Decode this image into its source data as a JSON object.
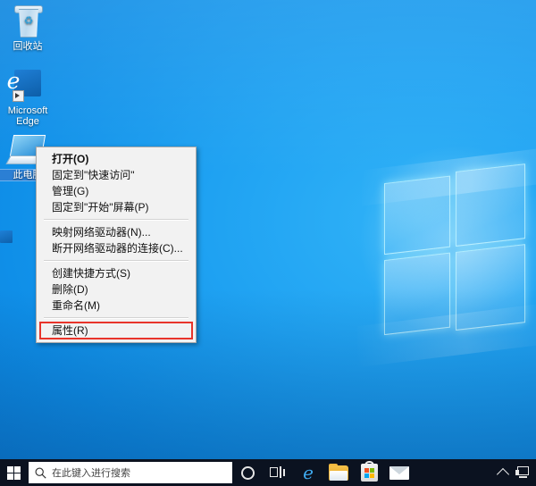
{
  "desktop": {
    "icons": [
      {
        "label": "回收站",
        "icon": "recycle-bin-icon",
        "selected": false
      },
      {
        "label": "Microsoft Edge",
        "icon": "edge-icon",
        "selected": false
      },
      {
        "label": "此电脑",
        "icon": "this-pc-icon",
        "selected": true
      }
    ]
  },
  "context_menu": {
    "groups": [
      {
        "items": [
          {
            "label": "打开(O)",
            "bold": true,
            "marked": false
          },
          {
            "label": "固定到\"快速访问\"",
            "bold": false,
            "marked": false
          },
          {
            "label": "管理(G)",
            "bold": false,
            "marked": false
          },
          {
            "label": "固定到\"开始\"屏幕(P)",
            "bold": false,
            "marked": false
          }
        ]
      },
      {
        "items": [
          {
            "label": "映射网络驱动器(N)...",
            "bold": false,
            "marked": false
          },
          {
            "label": "断开网络驱动器的连接(C)...",
            "bold": false,
            "marked": false
          }
        ]
      },
      {
        "items": [
          {
            "label": "创建快捷方式(S)",
            "bold": false,
            "marked": false
          },
          {
            "label": "删除(D)",
            "bold": false,
            "marked": false
          },
          {
            "label": "重命名(M)",
            "bold": false,
            "marked": false
          }
        ]
      },
      {
        "items": [
          {
            "label": "属性(R)",
            "bold": false,
            "marked": true
          }
        ]
      }
    ],
    "highlight_color": "#e8342a"
  },
  "taskbar": {
    "start_label": "开始",
    "search_placeholder": "在此键入进行搜索",
    "cortana_label": "Cortana",
    "taskview_label": "任务视图",
    "pinned": [
      {
        "name": "Microsoft Edge",
        "icon": "edge-icon"
      },
      {
        "name": "文件资源管理器",
        "icon": "file-explorer-icon"
      },
      {
        "name": "Microsoft Store",
        "icon": "store-icon"
      },
      {
        "name": "邮件",
        "icon": "mail-icon"
      }
    ],
    "tray": [
      {
        "name": "显示隐藏的图标",
        "icon": "chevron-up-icon"
      },
      {
        "name": "网络",
        "icon": "network-icon"
      }
    ],
    "background_color": "#0b1220"
  }
}
